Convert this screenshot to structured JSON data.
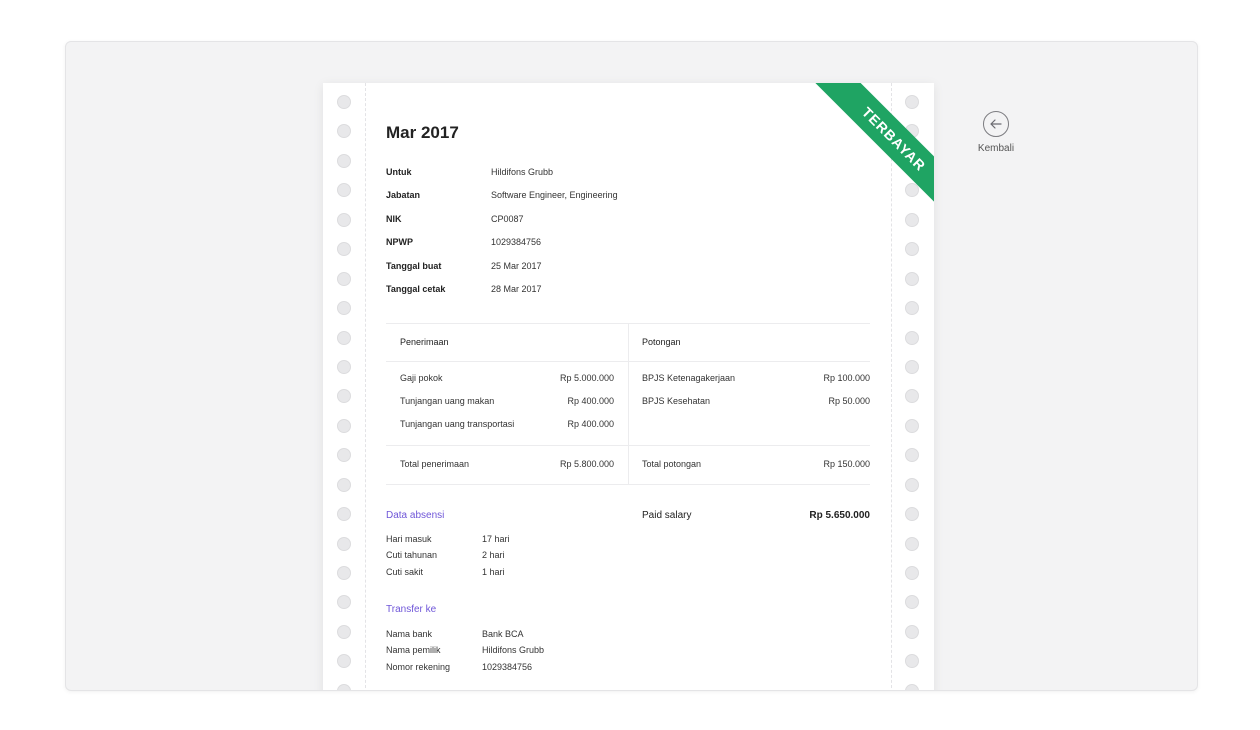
{
  "slip": {
    "period": "Mar 2017",
    "status_ribbon": "TERBAYAR",
    "info": [
      {
        "label": "Untuk",
        "value": "Hildifons Grubb"
      },
      {
        "label": "Jabatan",
        "value": "Software Engineer, Engineering"
      },
      {
        "label": "NIK",
        "value": "CP0087"
      },
      {
        "label": "NPWP",
        "value": "1029384756"
      },
      {
        "label": "Tanggal buat",
        "value": "25 Mar 2017"
      },
      {
        "label": "Tanggal cetak",
        "value": "28 Mar 2017"
      }
    ],
    "earnings": {
      "header": "Penerimaan",
      "items": [
        {
          "label": "Gaji pokok",
          "amount": "Rp 5.000.000"
        },
        {
          "label": "Tunjangan uang makan",
          "amount": "Rp 400.000"
        },
        {
          "label": "Tunjangan uang transportasi",
          "amount": "Rp 400.000"
        }
      ],
      "total_label": "Total penerimaan",
      "total_amount": "Rp 5.800.000"
    },
    "deductions": {
      "header": "Potongan",
      "items": [
        {
          "label": "BPJS Ketenagakerjaan",
          "amount": "Rp 100.000"
        },
        {
          "label": "BPJS Kesehatan",
          "amount": "Rp 50.000"
        }
      ],
      "total_label": "Total potongan",
      "total_amount": "Rp 150.000"
    },
    "paid_salary": {
      "label": "Paid salary",
      "amount": "Rp 5.650.000"
    },
    "attendance": {
      "title": "Data absensi",
      "rows": [
        {
          "label": "Hari masuk",
          "value": "17 hari"
        },
        {
          "label": "Cuti tahunan",
          "value": "2 hari"
        },
        {
          "label": "Cuti sakit",
          "value": "1 hari"
        }
      ]
    },
    "transfer": {
      "title": "Transfer ke",
      "rows": [
        {
          "label": "Nama bank",
          "value": "Bank BCA"
        },
        {
          "label": "Nama pemilik",
          "value": "Hildifons Grubb"
        },
        {
          "label": "Nomor rekening",
          "value": "1029384756"
        }
      ]
    }
  },
  "back": {
    "label": "Kembali",
    "icon": "arrow-left-circle-icon"
  },
  "colors": {
    "accent": "#6f56d8",
    "ribbon": "#1fa463",
    "background": "#f3f3f4"
  }
}
